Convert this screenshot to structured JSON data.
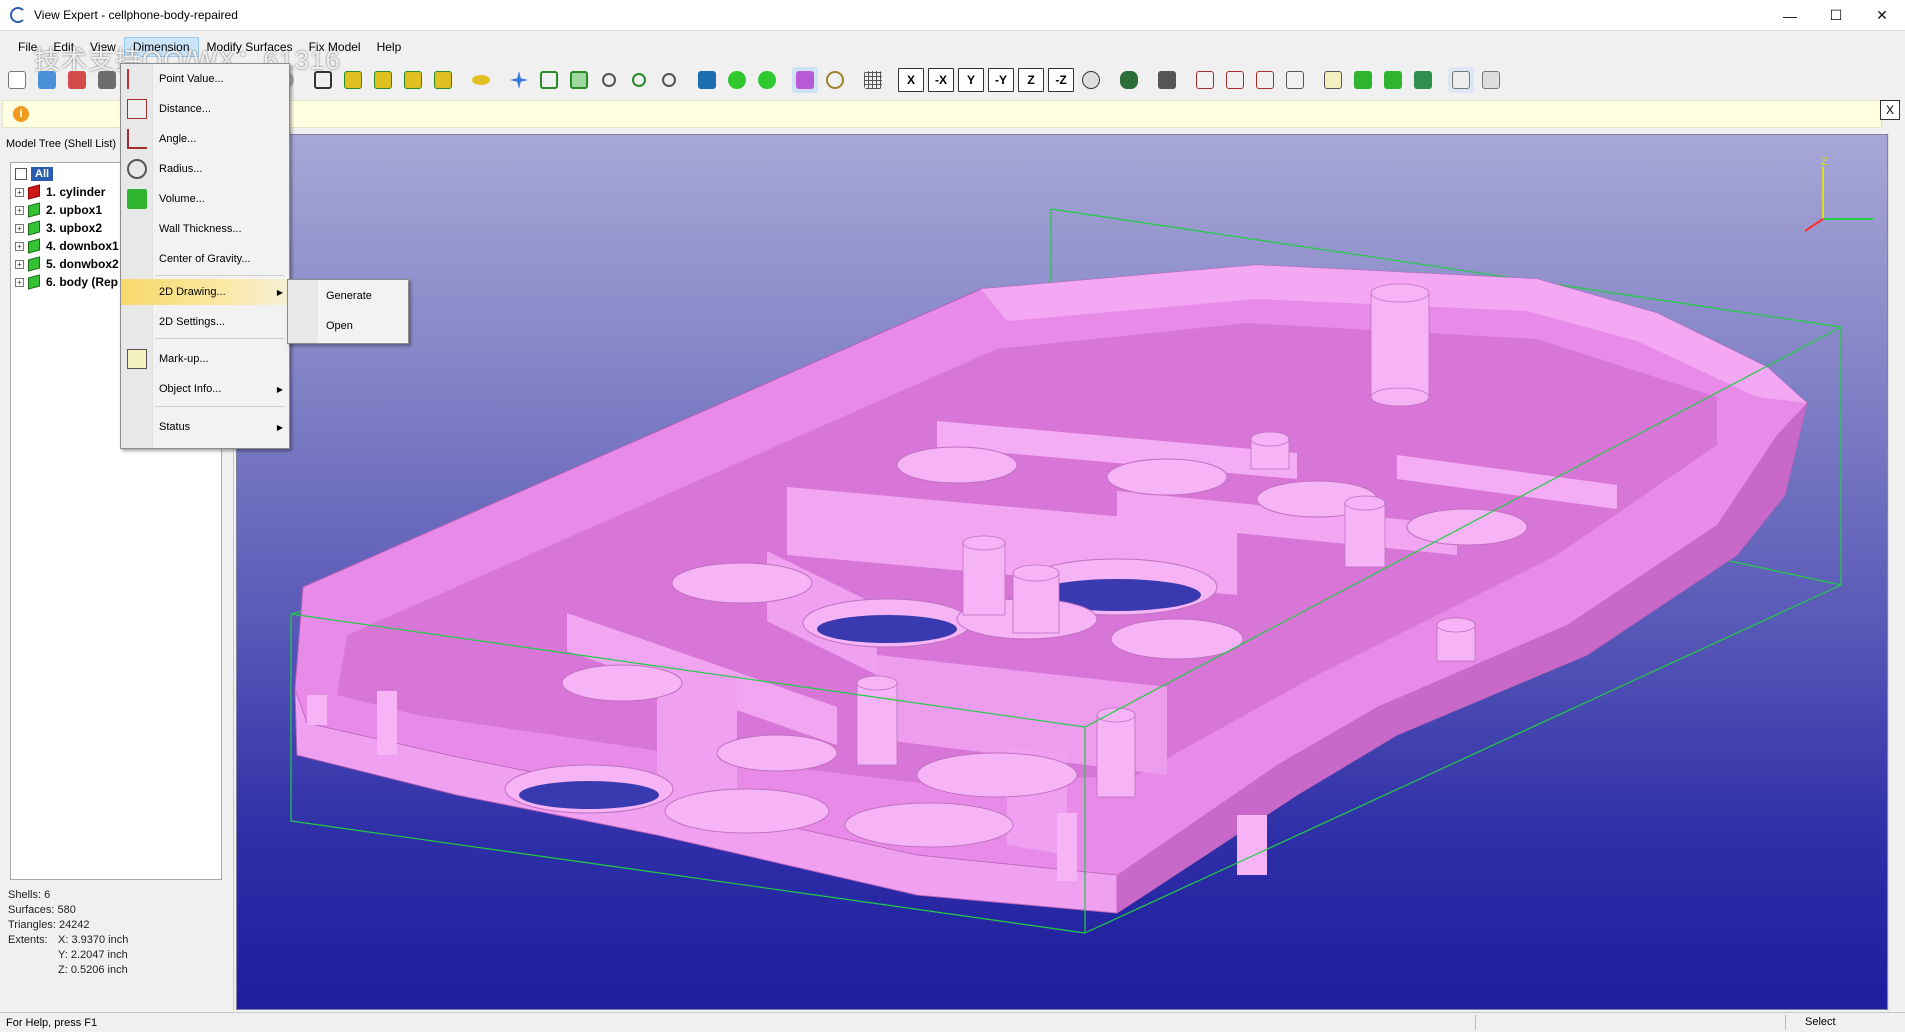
{
  "window": {
    "title": "View Expert - cellphone-body-repaired",
    "minimize_glyph": "—",
    "maximize_glyph": "☐",
    "close_glyph": "✕"
  },
  "watermark": "技术支持QQ/WX：61316",
  "menubar": {
    "items": [
      "File",
      "Edit",
      "View",
      "Dimension",
      "Modify Surfaces",
      "Fix Model",
      "Help"
    ]
  },
  "toolbar": {
    "axis_buttons": [
      "X",
      "-X",
      "Y",
      "-Y",
      "Z",
      "-Z"
    ]
  },
  "infobar": {
    "icon_text": "i",
    "close_glyph": "X"
  },
  "model_tree": {
    "title": "Model Tree (Shell List)",
    "root_label": "All",
    "items": [
      {
        "label": "1. cylinder",
        "color": "red"
      },
      {
        "label": "2. upbox1",
        "color": "green"
      },
      {
        "label": "3. upbox2",
        "color": "green"
      },
      {
        "label": "4. downbox1",
        "color": "green"
      },
      {
        "label": "5. donwbox2",
        "color": "green"
      },
      {
        "label": "6. body (Rep",
        "color": "green"
      }
    ]
  },
  "stats": {
    "shells": "Shells: 6",
    "surfaces": "Surfaces: 580",
    "triangles": "Triangles: 24242",
    "extents_label": "Extents:",
    "x": "X: 3.9370 inch",
    "y": "Y: 2.2047 inch",
    "z": "Z: 0.5206 inch"
  },
  "dimension_menu": {
    "items": [
      {
        "label": "Point Value..."
      },
      {
        "label": "Distance..."
      },
      {
        "label": "Angle..."
      },
      {
        "label": "Radius..."
      },
      {
        "label": "Volume..."
      },
      {
        "label": "Wall Thickness..."
      },
      {
        "label": "Center of Gravity..."
      },
      {
        "label": "2D Drawing..."
      },
      {
        "label": "2D Settings..."
      },
      {
        "label": "Mark-up..."
      },
      {
        "label": "Object Info..."
      },
      {
        "label": "Status"
      }
    ],
    "submenu_arrow": "▶"
  },
  "drawing_submenu": {
    "items": [
      "Generate",
      "Open"
    ]
  },
  "axis_indicator": {
    "z_label": "Z"
  },
  "statusbar": {
    "help": "For Help, press F1",
    "mode": "Select"
  },
  "colors": {
    "model": "#ee88ee",
    "bounding_box": "#22cc44",
    "viewport_top": "#a7a7d6",
    "viewport_bottom": "#1d1d9e"
  }
}
